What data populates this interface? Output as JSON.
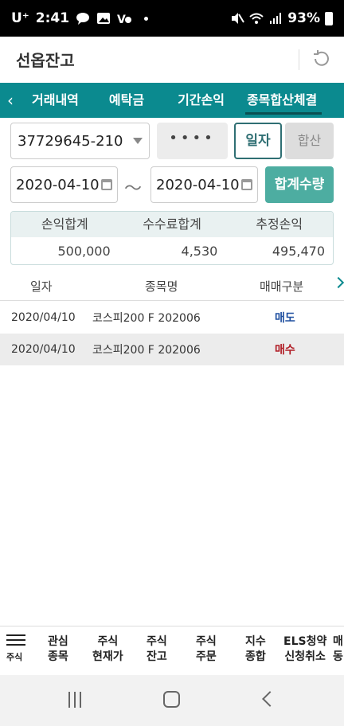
{
  "status_bar": {
    "carrier": "U⁺",
    "time": "2:41",
    "battery": "93%"
  },
  "header": {
    "title": "선옵잔고"
  },
  "tabs": [
    {
      "label": "거래내역"
    },
    {
      "label": "예탁금"
    },
    {
      "label": "기간손익"
    },
    {
      "label": "종목합산체결"
    }
  ],
  "form": {
    "account": "37729645-210",
    "password_mask": "••••",
    "btn_daily": "일자",
    "btn_sum": "합산",
    "date_from": "2020-04-10",
    "date_sep": "～",
    "date_to": "2020-04-10",
    "btn_qty": "합계수량"
  },
  "summary": {
    "headers": [
      "손익합계",
      "수수료합계",
      "추정손익"
    ],
    "values": [
      "500,000",
      "4,530",
      "495,470"
    ]
  },
  "table": {
    "headers": [
      "일자",
      "종목명",
      "매매구분"
    ],
    "rows": [
      {
        "date": "2020/04/10",
        "name": "코스피200 F 202006",
        "side": "매도"
      },
      {
        "date": "2020/04/10",
        "name": "코스피200 F 202006",
        "side": "매수"
      }
    ]
  },
  "bottom_menu": {
    "home_label": "주식",
    "items": [
      {
        "line1": "관심",
        "line2": "종목"
      },
      {
        "line1": "주식",
        "line2": "현재가"
      },
      {
        "line1": "주식",
        "line2": "잔고"
      },
      {
        "line1": "주식",
        "line2": "주문"
      },
      {
        "line1": "지수",
        "line2": "종합"
      },
      {
        "line1": "ELS청약",
        "line2": "신청취소"
      },
      {
        "line1": "매",
        "line2": "동"
      }
    ]
  },
  "colors": {
    "accent": "#0b8a8f",
    "profit": "#b01c25",
    "sell": "#1f4fa0",
    "buy": "#b01c25"
  }
}
